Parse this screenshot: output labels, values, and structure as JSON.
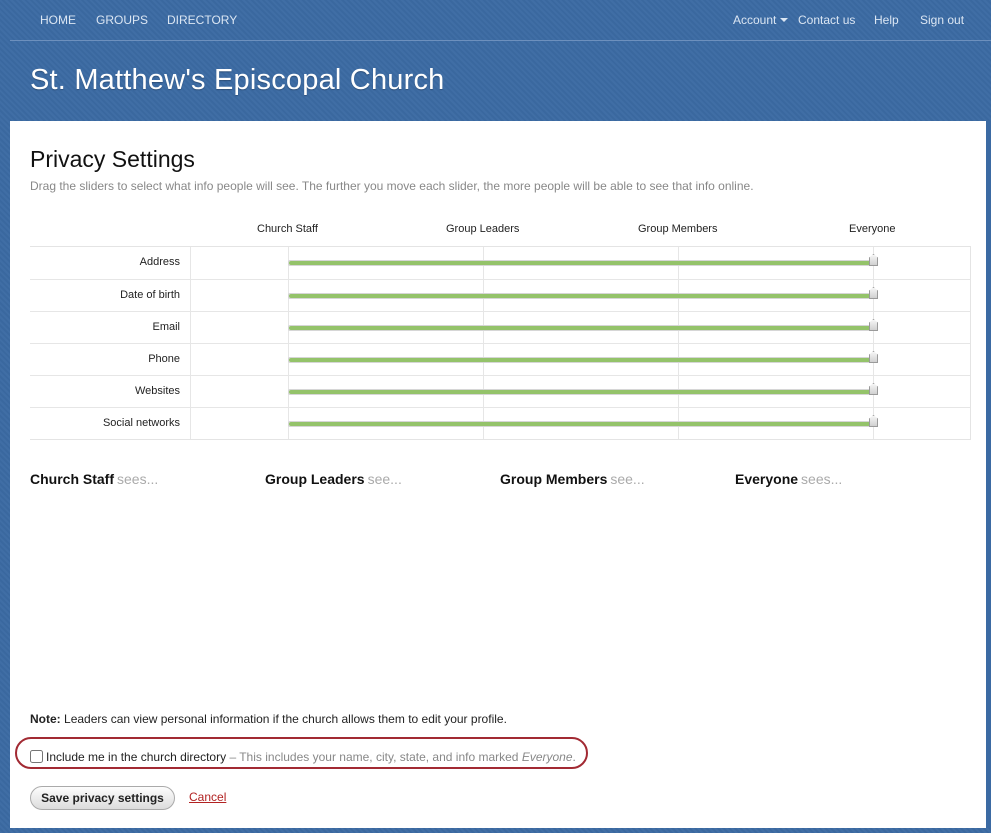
{
  "nav": {
    "left": [
      "HOME",
      "GROUPS",
      "DIRECTORY"
    ],
    "account": "Account",
    "contact": "Contact us",
    "help": "Help",
    "sign_out": "Sign out"
  },
  "site_title": "St. Matthew's Episcopal Church",
  "page": {
    "title": "Privacy Settings",
    "subtitle": "Drag the sliders to select what info people will see. The further you move each slider, the more people will be able to see that info online."
  },
  "audience_levels": [
    "Church Staff",
    "Group Leaders",
    "Group Members",
    "Everyone"
  ],
  "privacy_rows": [
    {
      "label": "Address",
      "level": "Everyone"
    },
    {
      "label": "Date of birth",
      "level": "Everyone"
    },
    {
      "label": "Email",
      "level": "Everyone"
    },
    {
      "label": "Phone",
      "level": "Everyone"
    },
    {
      "label": "Websites",
      "level": "Everyone"
    },
    {
      "label": "Social networks",
      "level": "Everyone"
    }
  ],
  "sees": [
    {
      "who": "Church Staff",
      "suffix": "sees..."
    },
    {
      "who": "Group Leaders",
      "suffix": "see..."
    },
    {
      "who": "Group Members",
      "suffix": "see..."
    },
    {
      "who": "Everyone",
      "suffix": "sees..."
    }
  ],
  "note": {
    "label": "Note:",
    "text": "Leaders can view personal information if the church allows them to edit your profile."
  },
  "directory": {
    "checked": false,
    "label": "Include me in the church directory",
    "desc": "– This includes your name, city, state, and info marked",
    "emph": "Everyone",
    "end": "."
  },
  "buttons": {
    "save": "Save privacy settings",
    "cancel": "Cancel"
  },
  "colors": {
    "header_bg": "#3b6aa3",
    "slider_fill": "#94c36a",
    "highlight": "#a22a33",
    "cancel": "#b22222"
  }
}
